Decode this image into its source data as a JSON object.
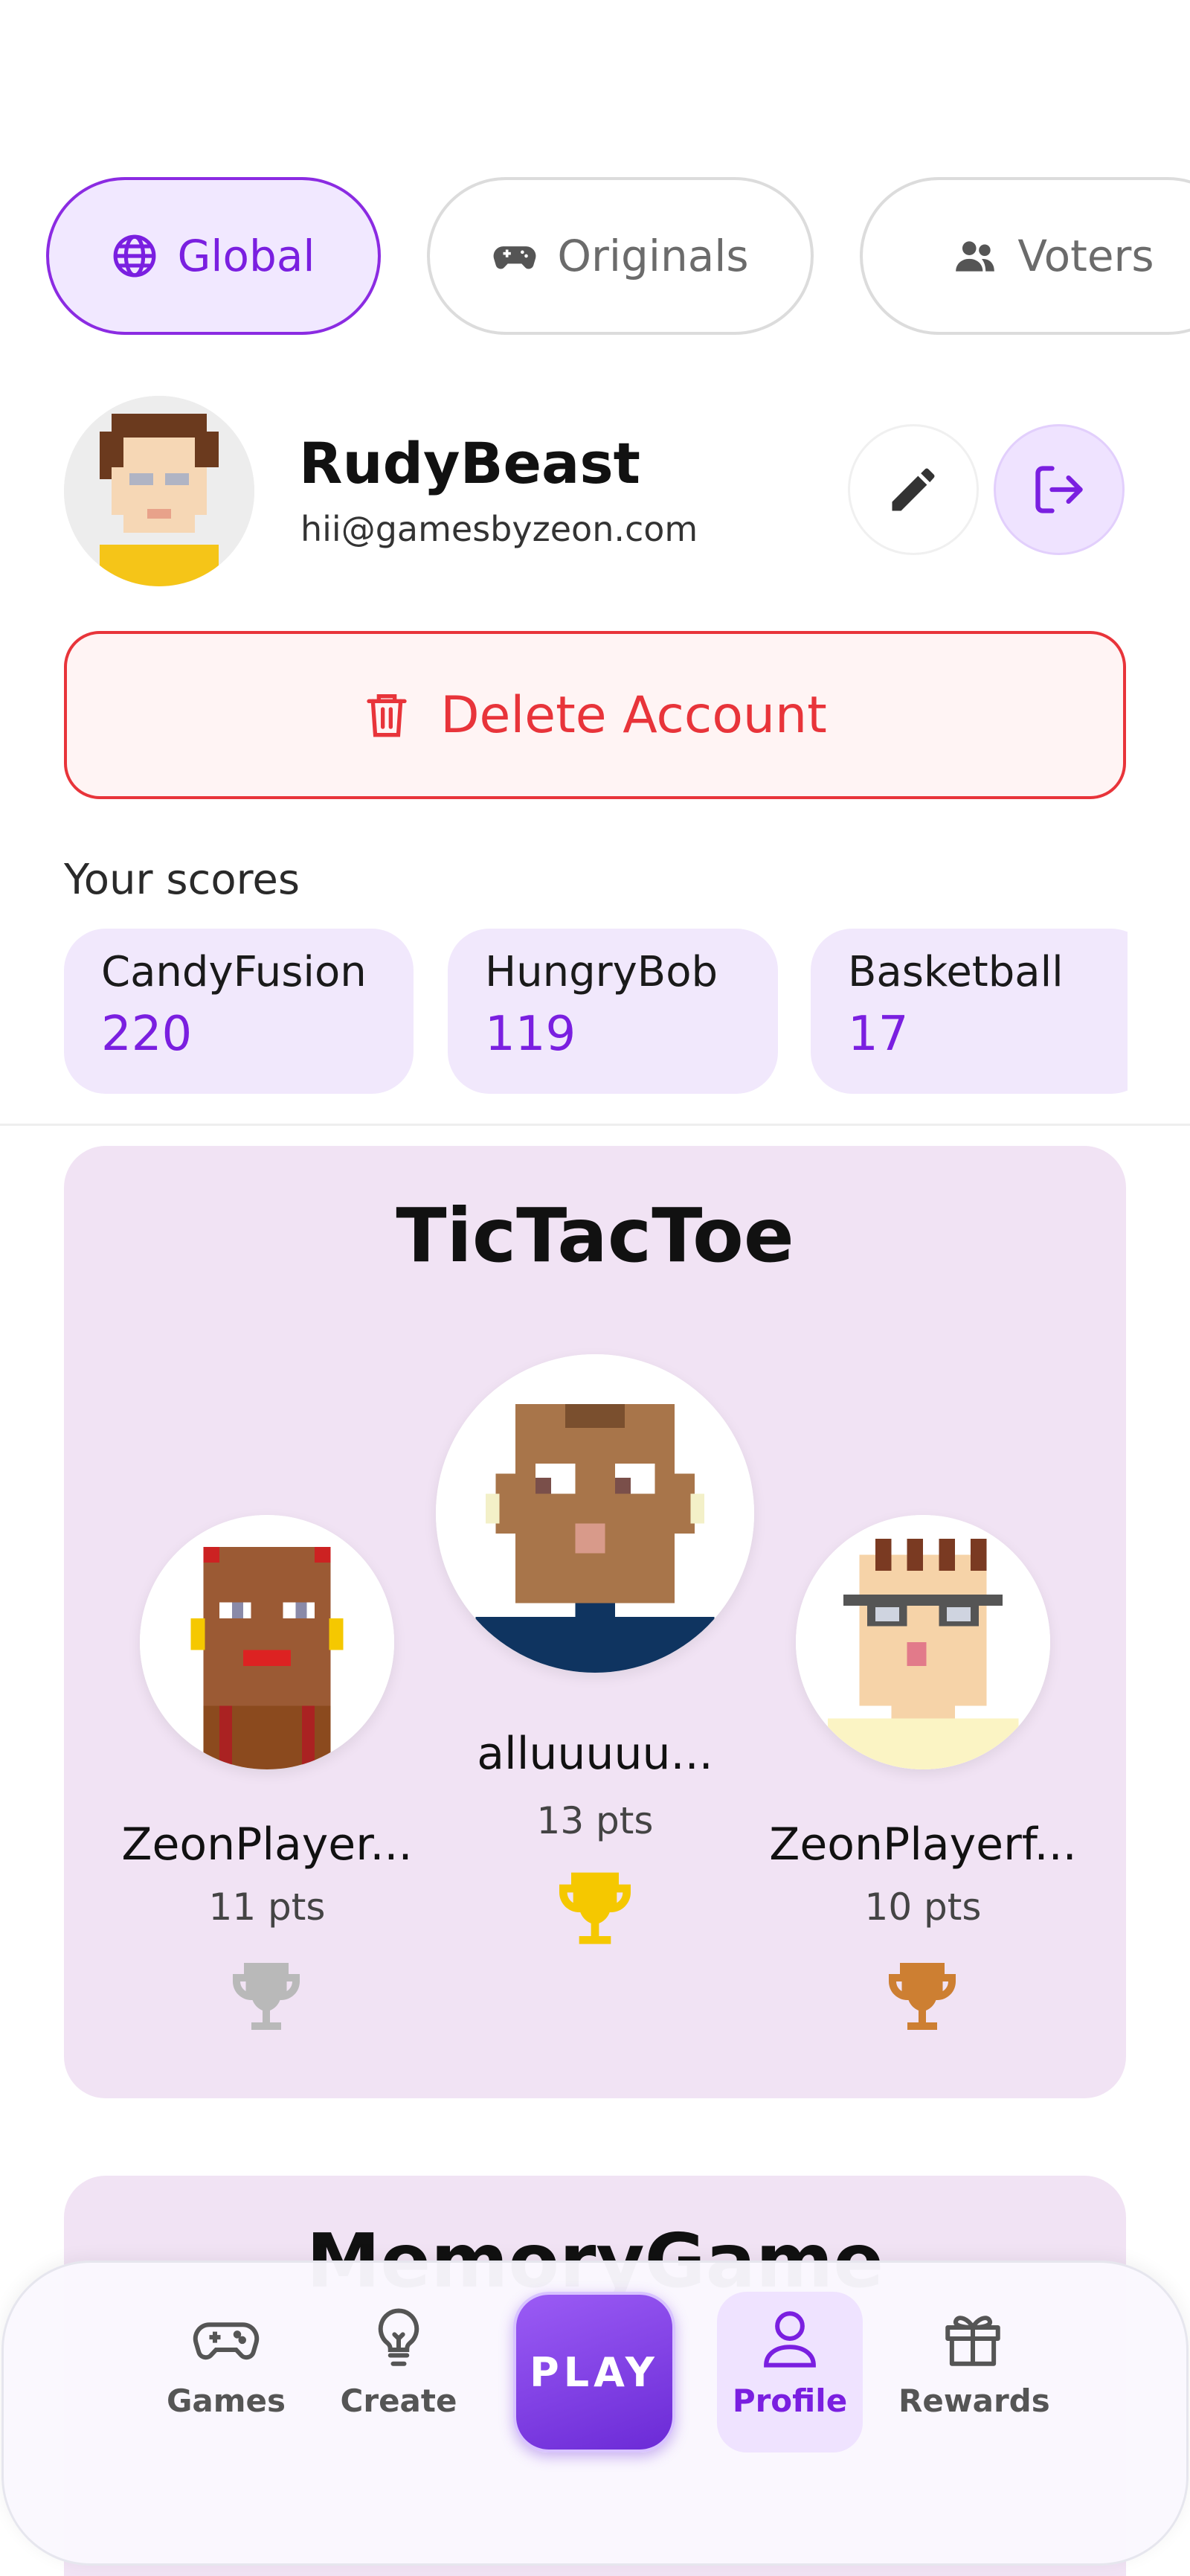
{
  "filters": {
    "global": "Global",
    "originals": "Originals",
    "voters": "Voters"
  },
  "profile": {
    "username": "RudyBeast",
    "email": "hii@gamesbyzeon.com"
  },
  "delete_account": "Delete Account",
  "scores": {
    "label": "Your scores",
    "items": [
      {
        "game": "CandyFusion",
        "value": "220"
      },
      {
        "game": "HungryBob",
        "value": "119"
      },
      {
        "game": "Basketball",
        "value": "17"
      }
    ]
  },
  "leaderboard": {
    "title": "TicTacToe",
    "first": {
      "name": "alluuuuu...",
      "points": "13 pts"
    },
    "second": {
      "name": "ZeonPlayer...",
      "points": "11 pts"
    },
    "third": {
      "name": "ZeonPlayerf...",
      "points": "10 pts"
    }
  },
  "next_leaderboard": {
    "title": "MemoryGame"
  },
  "nav": {
    "games": "Games",
    "create": "Create",
    "play": "PLAY",
    "profile": "Profile",
    "rewards": "Rewards"
  },
  "colors": {
    "accent": "#7a1fe0",
    "danger": "#e8343a",
    "gold": "#f5c800",
    "silver": "#b9b9b9",
    "bronze": "#cd7f32"
  }
}
